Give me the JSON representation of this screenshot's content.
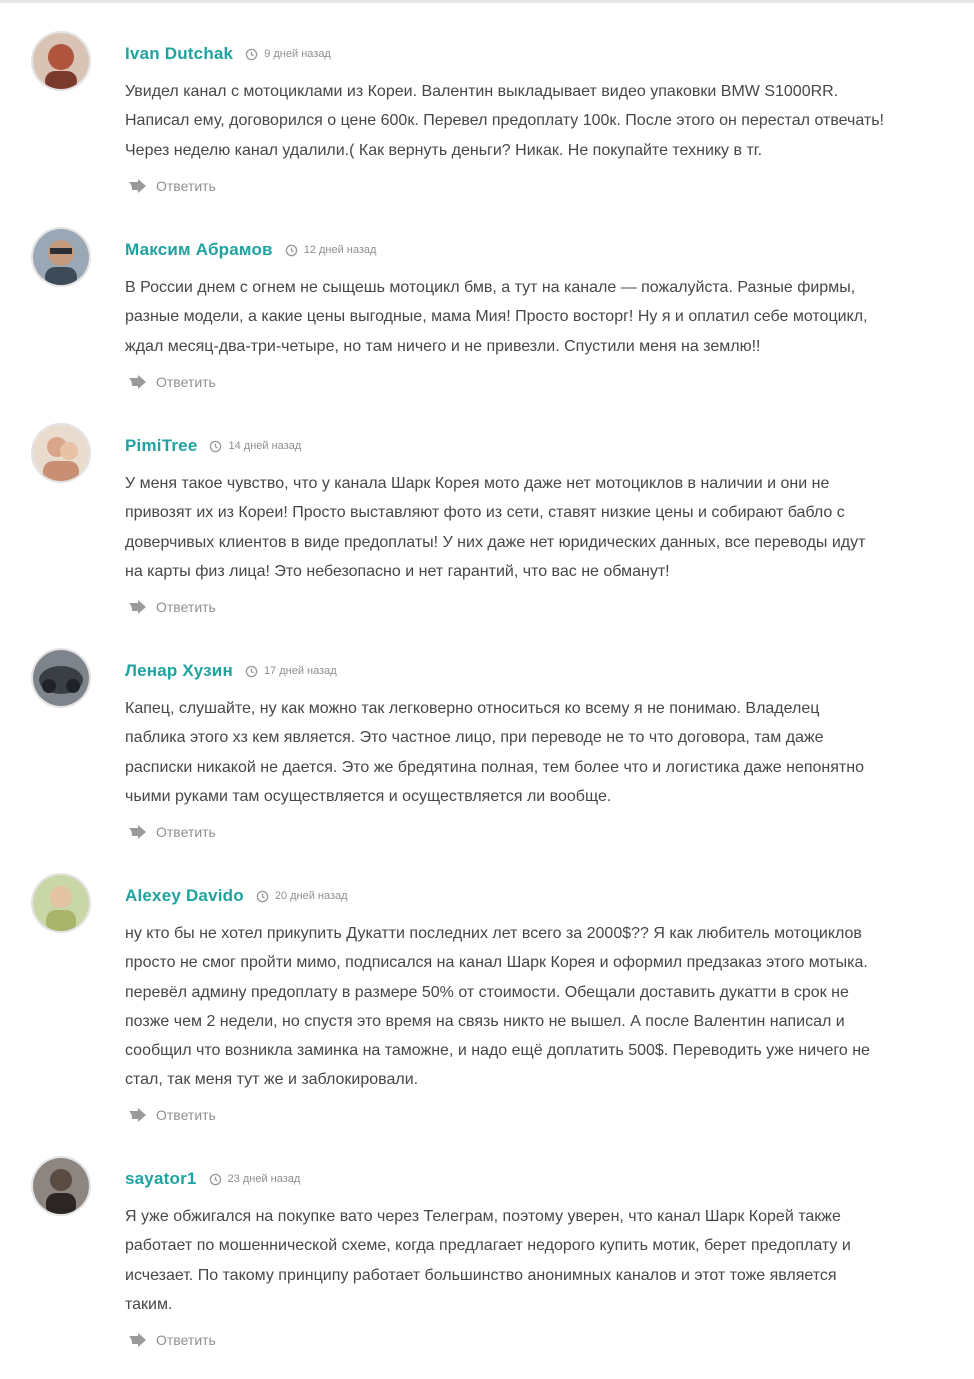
{
  "comments": [
    {
      "author": "Ivan Dutchak",
      "date": "9 дней назад",
      "text": "Увидел канал с мотоциклами из Кореи. Валентин выкладывает видео упаковки BMW S1000RR.\nНаписал ему, договорился о цене 600к. Перевел предоплату 100к. После этого он перестал отвечать!\nЧерез неделю канал удалили.( Как вернуть деньги? Никак. Не покупайте технику в тг.",
      "reply_label": "Ответить",
      "avatar_color": "#b0553d"
    },
    {
      "author": "Максим Абрамов",
      "date": "12 дней назад",
      "text": "В России днем с огнем не сыщешь мотоцикл бмв, а тут на канале — пожалуйста. Разные фирмы,\nразные модели, а какие цены выгодные, мама Мия! Просто восторг! Ну я и оплатил себе мотоцикл,\nждал месяц-два-три-четыре, но там ничего и не привезли. Спустили меня на землю!!",
      "reply_label": "Ответить",
      "avatar_color": "#3d4a57"
    },
    {
      "author": "PimiTree",
      "date": "14 дней назад",
      "text": "У меня такое чувство, что у канала Шарк Корея мото даже нет мотоциклов в наличии и они не\nпривозят их из Кореи! Просто выставляют фото из сети, ставят низкие цены и собирают бабло с\nдоверчивых клиентов в виде предоплаты! У них даже нет юридических данных, все переводы идут\nна карты физ лица! Это небезопасно и нет гарантий, что вас не обманут!",
      "reply_label": "Ответить",
      "avatar_color": "#d9a58b"
    },
    {
      "author": "Ленар Хузин",
      "date": "17 дней назад",
      "text": "Капец, слушайте, ну как можно так легковерно относиться ко всему я не понимаю. Владелец\nпаблика этого хз кем является. Это частное лицо, при переводе не то что договора, там даже\nрасписки никакой не дается. Это же бредятина полная, тем более что и логистика даже непонятно\nчьими руками там осуществляется и осуществляется ли вообще.",
      "reply_label": "Ответить",
      "avatar_color": "#3a3f45"
    },
    {
      "author": "Alexey Davido",
      "date": "20 дней назад",
      "text": "ну кто бы не хотел прикупить Дукатти последних лет всего за 2000$?? Я как любитель мотоциклов\nпросто не смог пройти мимо, подписался на канал Шарк Корея и оформил предзаказ этого мотыка.\nперевёл админу предоплату в размере 50% от стоимости. Обещали доставить дукатти в срок не\nпозже чем 2 недели, но спустя это время на связь никто не вышел. А после Валентин написал и\nсообщил что возникла заминка на таможне, и надо ещё доплатить 500$. Переводить уже ничего не\nстал, так меня тут же и заблокировали.",
      "reply_label": "Ответить",
      "avatar_color": "#a8b56a"
    },
    {
      "author": "sayator1",
      "date": "23 дней назад",
      "text": "Я уже обжигался на покупке вато через Телеграм, поэтому уверен, что канал Шарк Корей также\nработает по мошеннической схеме, когда предлагает недорого купить мотик, берет предоплату и\nисчезает. По такому принципу работает большинство анонимных каналов и этот тоже является\nтаким.",
      "reply_label": "Ответить",
      "avatar_color": "#2b2623"
    }
  ]
}
